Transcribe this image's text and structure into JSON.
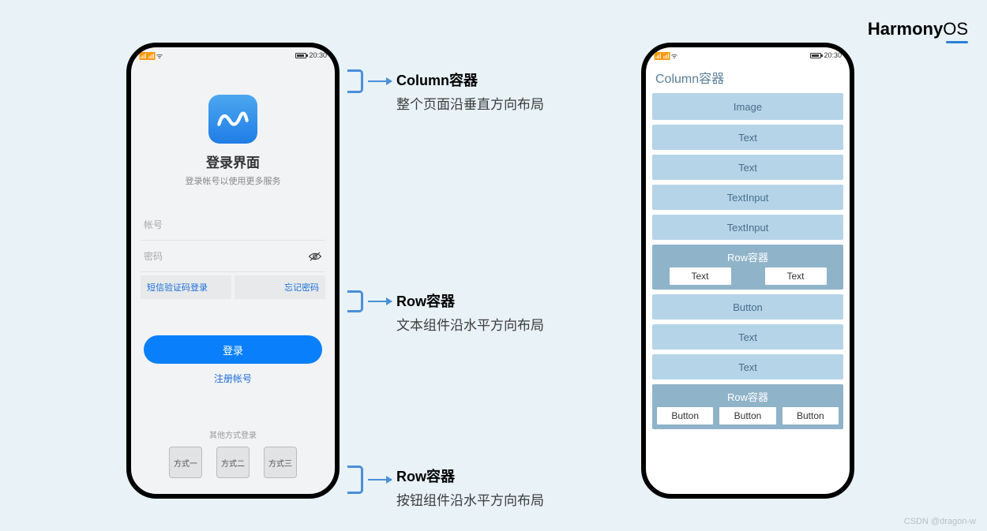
{
  "brand": {
    "name": "Harmony",
    "suffix": "OS"
  },
  "watermark": "CSDN @dragon-w",
  "status": {
    "time": "20:30"
  },
  "login": {
    "title": "登录界面",
    "subtitle": "登录帐号以使用更多服务",
    "account_placeholder": "帐号",
    "password_placeholder": "密码",
    "sms_login": "短信验证码登录",
    "forgot": "忘记密码",
    "login_btn": "登录",
    "register": "注册帐号",
    "other_title": "其他方式登录",
    "methods": [
      "方式一",
      "方式二",
      "方式三"
    ]
  },
  "schema": {
    "column_title": "Column容器",
    "items": [
      "Image",
      "Text",
      "Text",
      "TextInput",
      "TextInput"
    ],
    "row1": {
      "label": "Row容器",
      "cells": [
        "Text",
        "Text"
      ]
    },
    "mid_items": [
      "Button",
      "Text",
      "Text"
    ],
    "row2": {
      "label": "Row容器",
      "cells": [
        "Button",
        "Button",
        "Button"
      ]
    }
  },
  "annotations": {
    "a1": {
      "h": "Column容器",
      "d": "整个页面沿垂直方向布局"
    },
    "a2": {
      "h": "Row容器",
      "d": "文本组件沿水平方向布局"
    },
    "a3": {
      "h": "Row容器",
      "d": "按钮组件沿水平方向布局"
    }
  }
}
